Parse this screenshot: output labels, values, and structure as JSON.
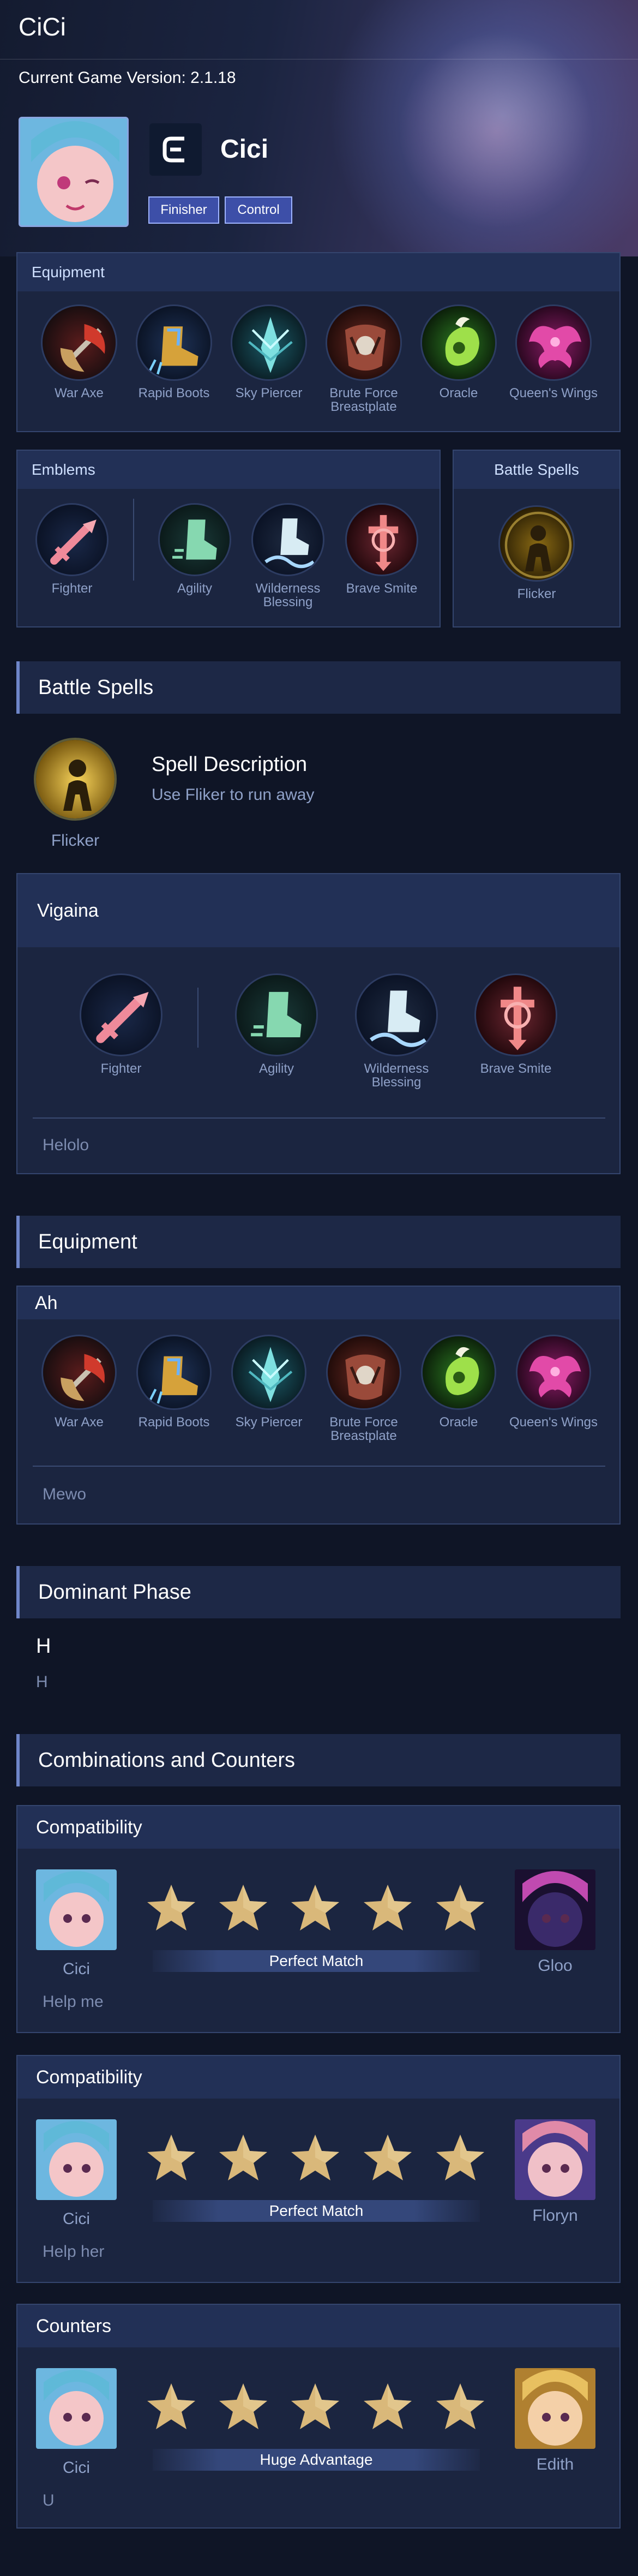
{
  "app_title": "CiCi",
  "version_label": "Current Game Version: 2.1.18",
  "hero": {
    "name": "Cici",
    "role_icon": "role-letter-e-icon",
    "tags": [
      "Finisher",
      "Control"
    ]
  },
  "equipment_panel": {
    "title": "Equipment",
    "items": [
      "War Axe",
      "Rapid Boots",
      "Sky Piercer",
      "Brute Force Breastplate",
      "Oracle",
      "Queen's Wings"
    ]
  },
  "emblems_panel": {
    "title": "Emblems",
    "main": "Fighter",
    "talents": [
      "Agility",
      "Wilderness Blessing",
      "Brave Smite"
    ]
  },
  "spells_panel": {
    "title": "Battle Spells",
    "spell": "Flicker"
  },
  "battle_spells": {
    "heading": "Battle Spells",
    "spell": "Flicker",
    "desc_title": "Spell Description",
    "desc_text": "Use Fliker to run away"
  },
  "emblem_build": {
    "title": "Vigaina",
    "main": "Fighter",
    "talents": [
      "Agility",
      "Wilderness Blessing",
      "Brave Smite"
    ],
    "note": "Helolo"
  },
  "equipment_section": {
    "heading": "Equipment",
    "build_title": "Ah",
    "items": [
      "War Axe",
      "Rapid Boots",
      "Sky Piercer",
      "Brute Force Breastplate",
      "Oracle",
      "Queen's Wings"
    ],
    "note": "Mewo"
  },
  "dominant_phase": {
    "heading": "Dominant Phase",
    "title": "H",
    "text": "H"
  },
  "combos": {
    "heading": "Combinations and Counters",
    "cards": [
      {
        "title": "Compatibility",
        "left": "Cici",
        "right": "Gloo",
        "stars": 5,
        "rating": "Perfect Match",
        "note": "Help me"
      },
      {
        "title": "Compatibility",
        "left": "Cici",
        "right": "Floryn",
        "stars": 5,
        "rating": "Perfect Match",
        "note": "Help her"
      },
      {
        "title": "Counters",
        "left": "Cici",
        "right": "Edith",
        "stars": 5,
        "rating": "Huge Advantage",
        "note": "U"
      }
    ]
  },
  "colors": {
    "accent": "#6f86c9",
    "tag_fill": "#3d4fa8",
    "star": "#d9b87a",
    "background": "#0f1526"
  }
}
